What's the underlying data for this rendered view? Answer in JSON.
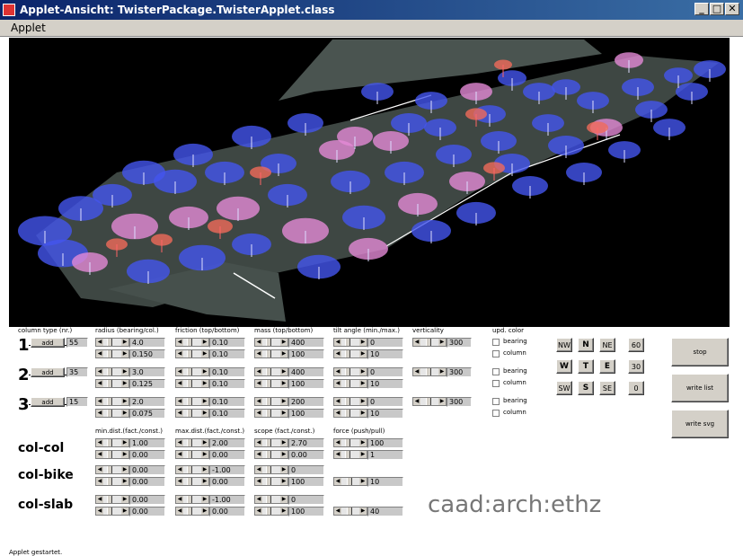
{
  "window": {
    "title": "Applet-Ansicht: TwisterPackage.TwisterApplet.class",
    "controls": [
      "_",
      "□",
      "✕"
    ]
  },
  "menu": {
    "items": [
      "Applet"
    ]
  },
  "headers": {
    "column_type": "column type (nr.)",
    "radius": "radius (bearing/col.)",
    "friction": "friction (top/bottom)",
    "mass": "mass (top/bottom)",
    "tilt": "tilt angle (min./max.)",
    "verticality": "verticality",
    "upd_color": "upd. color",
    "min_dist": "min.dist.(fact./const.)",
    "max_dist": "max.dist.(fact./const.)",
    "scope": "scope (fact./const.)",
    "force": "force (push/pull)"
  },
  "column_types": [
    {
      "num": "1",
      "add_label": "add",
      "count": "55",
      "radius": [
        "4.0",
        "0.150"
      ],
      "friction": [
        "0.10",
        "0.10"
      ],
      "mass": [
        "400",
        "100"
      ],
      "tilt": [
        "0",
        "10"
      ],
      "verticality": "300",
      "colors": [
        "bearing",
        "column"
      ]
    },
    {
      "num": "2",
      "add_label": "add",
      "count": "35",
      "radius": [
        "3.0",
        "0.125"
      ],
      "friction": [
        "0.10",
        "0.10"
      ],
      "mass": [
        "400",
        "100"
      ],
      "tilt": [
        "0",
        "10"
      ],
      "verticality": "300",
      "colors": [
        "bearing",
        "column"
      ]
    },
    {
      "num": "3",
      "add_label": "add",
      "count": "15",
      "radius": [
        "2.0",
        "0.075"
      ],
      "friction": [
        "0.10",
        "0.10"
      ],
      "mass": [
        "200",
        "100"
      ],
      "tilt": [
        "0",
        "10"
      ],
      "verticality": "300",
      "colors": [
        "bearing",
        "column"
      ]
    }
  ],
  "interactions": [
    {
      "name": "col-col",
      "min_dist": [
        "1.00",
        "0.00"
      ],
      "max_dist": [
        "2.00",
        "0.00"
      ],
      "scope": [
        "2.70",
        "0.00"
      ],
      "force": [
        "100",
        "1"
      ]
    },
    {
      "name": "col-bike",
      "min_dist": [
        "0.00",
        "0.00"
      ],
      "max_dist": [
        "-1.00",
        "0.00"
      ],
      "scope": [
        "0",
        "100"
      ],
      "force": [
        "10"
      ]
    },
    {
      "name": "col-slab",
      "min_dist": [
        "0.00",
        "0.00"
      ],
      "max_dist": [
        "-1.00",
        "0.00"
      ],
      "scope": [
        "0",
        "100"
      ],
      "force": [
        "40"
      ]
    }
  ],
  "compass": {
    "NW": "NW",
    "N": "N",
    "NE": "NE",
    "W": "W",
    "T": "T",
    "E": "E",
    "SW": "SW",
    "S": "S",
    "SE": "SE"
  },
  "angles": [
    "60",
    "30",
    "0"
  ],
  "actions": {
    "stop": "stop",
    "write_list": "write list",
    "write_svg": "write svg"
  },
  "logo": "caad:arch:ethz",
  "status": "Applet gestartet.",
  "colors": {
    "titlebar": "#0a246a",
    "disc_blue": "#4455ee",
    "disc_pink": "#e38ad6",
    "disc_red": "#f06a5a",
    "slab": "#4a5450"
  }
}
